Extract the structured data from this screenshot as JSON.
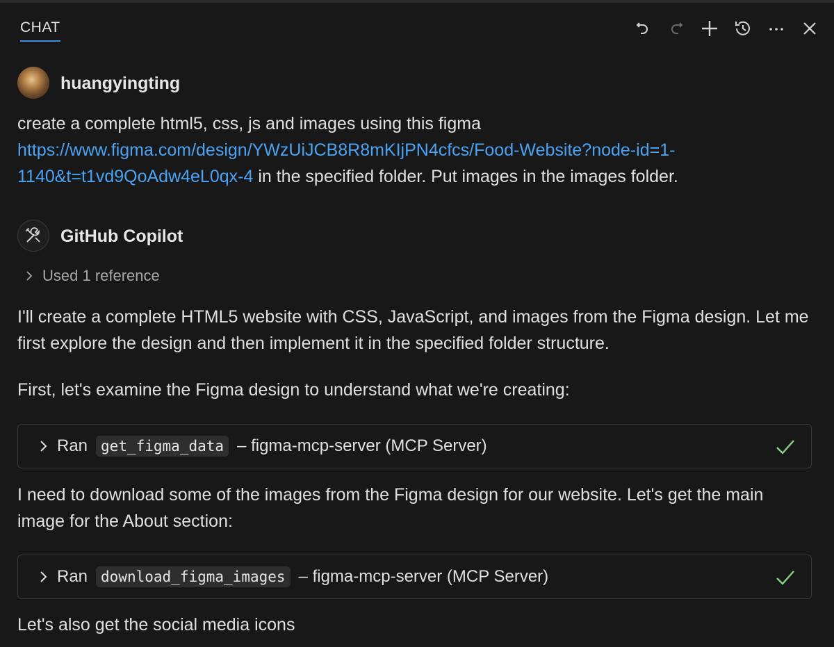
{
  "header": {
    "tab_label": "CHAT",
    "toolbar": [
      "undo-icon",
      "redo-icon",
      "new-chat-icon",
      "history-icon",
      "more-icon",
      "close-icon"
    ]
  },
  "colors": {
    "background": "#181818",
    "link": "#4aa3f5",
    "accent": "#3c8ce7",
    "check": "#89d185"
  },
  "messages": {
    "user": {
      "name": "huangyingting",
      "line1": "create a complete html5, css, js and images using this figma",
      "link_part1": "https://www.figma.com/design/YWzUiJCB8R8mKIjPN4cfcs/Food-Website?node-id=1-",
      "link_part2": "1140&t=t1vd9QoAdw4eL0qx-4",
      "line3_rest": " in the specified folder. Put images in the images folder."
    },
    "bot": {
      "name": "GitHub Copilot",
      "reference": "Used 1 reference",
      "para1_line1": "I'll create a complete HTML5 website with CSS, JavaScript, and images from the Figma design. Let me",
      "para1_line2": "first explore the design and then implement it in the specified folder structure.",
      "para2": "First, let's examine the Figma design to understand what we're creating:",
      "tool1": {
        "ran": "Ran",
        "code": "get_figma_data",
        "desc": "– figma-mcp-server (MCP Server)"
      },
      "para3_line1": "I need to download some of the images from the Figma design for our website. Let's get the main",
      "para3_line2": "image for the About section:",
      "tool2": {
        "ran": "Ran",
        "code": "download_figma_images",
        "desc": "– figma-mcp-server (MCP Server)"
      },
      "para4": "Let's also get the social media icons"
    }
  }
}
